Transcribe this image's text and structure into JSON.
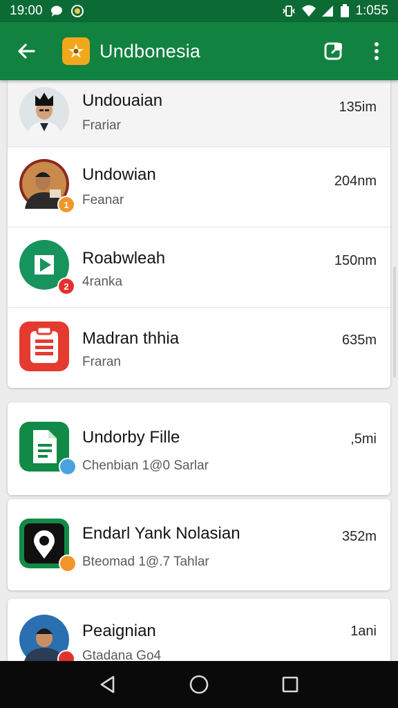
{
  "status_bar": {
    "time": "19:00",
    "battery_text": "1:055",
    "icons": [
      "chat-bubble-icon",
      "emblem-icon",
      "vibrate-icon",
      "wifi-icon",
      "signal-icon",
      "battery-icon"
    ]
  },
  "app_bar": {
    "title": "Undbonesia",
    "back_icon": "arrow-left-icon",
    "actions": [
      "compose-icon",
      "more-vertical-icon"
    ],
    "color": "#11823f"
  },
  "cards": [
    {
      "rows": [
        {
          "title": "Undouaian",
          "subtitle": "Frariar",
          "meta": "135im",
          "avatar": "person-portrait",
          "badge": null
        },
        {
          "title": "Undowian",
          "subtitle": "Feanar",
          "meta": "204nm",
          "avatar": "person-portrait",
          "badge": "1"
        },
        {
          "title": "Roabwleah",
          "subtitle": "4ranka",
          "meta": "150nm",
          "avatar": "play-icon",
          "badge": "2"
        },
        {
          "title": "Madran thhia",
          "subtitle": "Fraran",
          "meta": "635m",
          "avatar": "clipboard-icon",
          "badge": null
        }
      ]
    },
    {
      "rows": [
        {
          "title": "Undorby Fille",
          "subtitle": "Chenbian 1@0 Sarlar",
          "meta": ",5mi",
          "avatar": "document-icon",
          "badge": ""
        }
      ]
    },
    {
      "rows": [
        {
          "title": "Endarl Yank Nolasian",
          "subtitle": "Bteomad 1@.7 Tahlar",
          "meta": "352m",
          "avatar": "map-pin-icon",
          "badge": ""
        }
      ]
    },
    {
      "rows": [
        {
          "title": "Peaignian",
          "subtitle": "Gtadana Go4",
          "meta": "1ani",
          "avatar": "person-portrait",
          "badge": ""
        }
      ]
    }
  ],
  "nav_bar": {
    "icons": [
      "back-triangle-icon",
      "home-circle-icon",
      "recents-square-icon"
    ]
  },
  "colors": {
    "primary": "#11823f",
    "status": "#0c6a34",
    "badge_orange": "#f2952b",
    "badge_red": "#e3322e",
    "badge_blue": "#4aa3df"
  }
}
